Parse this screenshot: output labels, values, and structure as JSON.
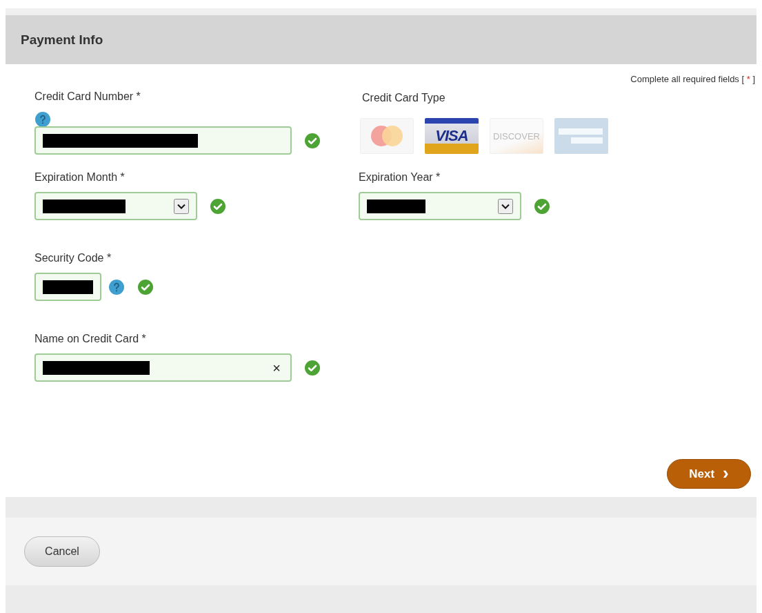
{
  "panel": {
    "title": "Payment Info",
    "required_note": {
      "text": "Complete all required fields [",
      "mark": "*",
      "end": "]"
    }
  },
  "fields": [
    {
      "kind": "text",
      "label": "Credit Card Number *",
      "help_above": true,
      "redacted": true,
      "valid": true
    },
    {
      "kind": "select",
      "label": "Expiration Month *",
      "redacted": true,
      "valid": true
    },
    {
      "kind": "select",
      "label": "Expiration Year *",
      "redacted": true,
      "valid": true
    },
    {
      "kind": "short",
      "label": "Security Code *",
      "help_after": true,
      "redacted": true,
      "valid": true
    },
    {
      "kind": "text",
      "label": "Name on Credit Card *",
      "redacted": true,
      "valid": true,
      "clear_button": "×"
    }
  ],
  "card_type": {
    "label": "Credit Card Type",
    "cards": [
      {
        "kind": "mastercard",
        "selected": false
      },
      {
        "kind": "visa",
        "label": "VISA",
        "selected": true
      },
      {
        "kind": "discover",
        "label": "DISCOVER",
        "selected": false
      },
      {
        "kind": "amex",
        "selected": false
      }
    ]
  },
  "buttons": {
    "next": "Next",
    "next_icon": "›",
    "cancel": "Cancel"
  }
}
